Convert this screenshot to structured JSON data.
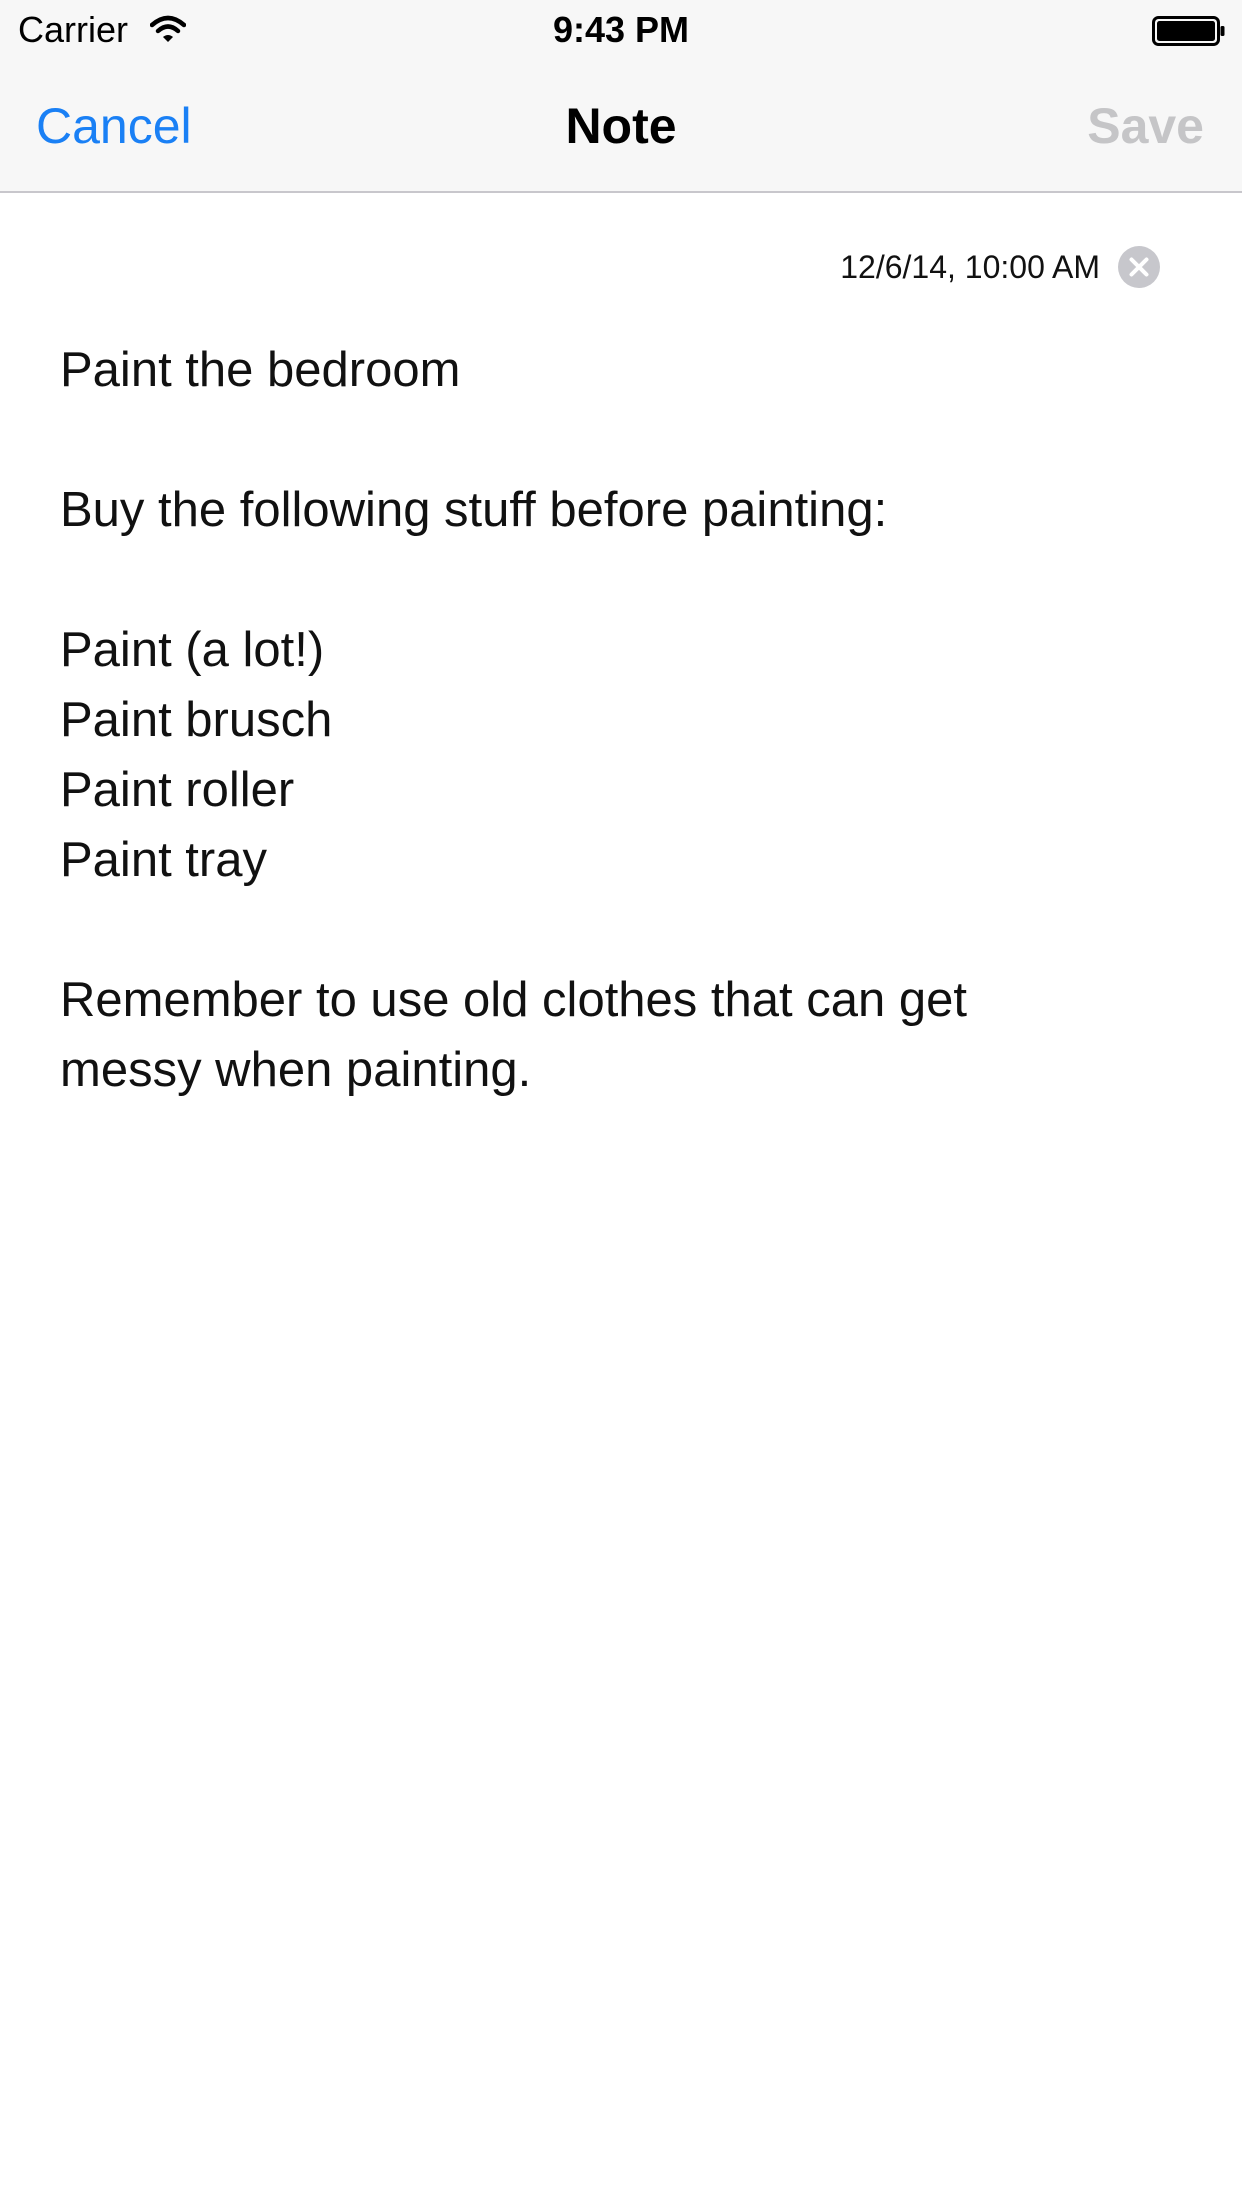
{
  "status_bar": {
    "carrier": "Carrier",
    "time": "9:43 PM",
    "icons": [
      "wifi-icon",
      "battery-icon"
    ]
  },
  "nav": {
    "cancel_label": "Cancel",
    "title": "Note",
    "save_label": "Save"
  },
  "note": {
    "date": "12/6/14, 10:00 AM",
    "clear_icon": "clear-circle-icon",
    "lines": {
      "line0": "Paint the bedroom",
      "line1": "Buy the following stuff before painting:",
      "line2": "Paint (a lot!)",
      "line3": "Paint brusch",
      "line4": "Paint roller",
      "line5": "Paint tray",
      "line6": "Remember to use old clothes that can get",
      "line7": "messy when painting."
    }
  },
  "colors": {
    "accent": "#1a80f5",
    "disabled": "#c5c5c7",
    "bar_background": "#f7f7f7"
  }
}
